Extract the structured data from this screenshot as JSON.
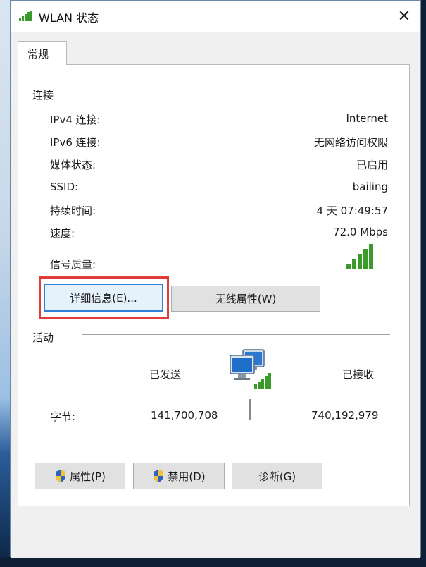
{
  "window": {
    "title": "WLAN 状态",
    "close_glyph": "✕"
  },
  "tab": {
    "label": "常规"
  },
  "connection": {
    "heading": "连接",
    "rows": [
      {
        "label": "IPv4 连接:",
        "value": "Internet"
      },
      {
        "label": "IPv6 连接:",
        "value": "无网络访问权限"
      },
      {
        "label": "媒体状态:",
        "value": "已启用"
      },
      {
        "label": "SSID:",
        "value": "bailing"
      },
      {
        "label": "持续时间:",
        "value": "4 天 07:49:57"
      },
      {
        "label": "速度:",
        "value": "72.0 Mbps"
      }
    ],
    "signal_label": "信号质量:",
    "signal_icon": "signal-bars-icon",
    "signal_bars": 5
  },
  "buttons": {
    "details": "详细信息(E)...",
    "wireless_props": "无线属性(W)",
    "properties": "属性(P)",
    "disable": "禁用(D)",
    "diagnose": "诊断(G)"
  },
  "activity": {
    "heading": "活动",
    "sent_label": "已发送",
    "received_label": "已接收",
    "bytes_label": "字节:",
    "bytes_sent": "141,700,708",
    "bytes_received": "740,192,979",
    "icon": "network-computers-icon"
  },
  "colors": {
    "highlight": "#e23b3b",
    "focus": "#2f7fd8",
    "signal_green": "#3a9a2a"
  }
}
